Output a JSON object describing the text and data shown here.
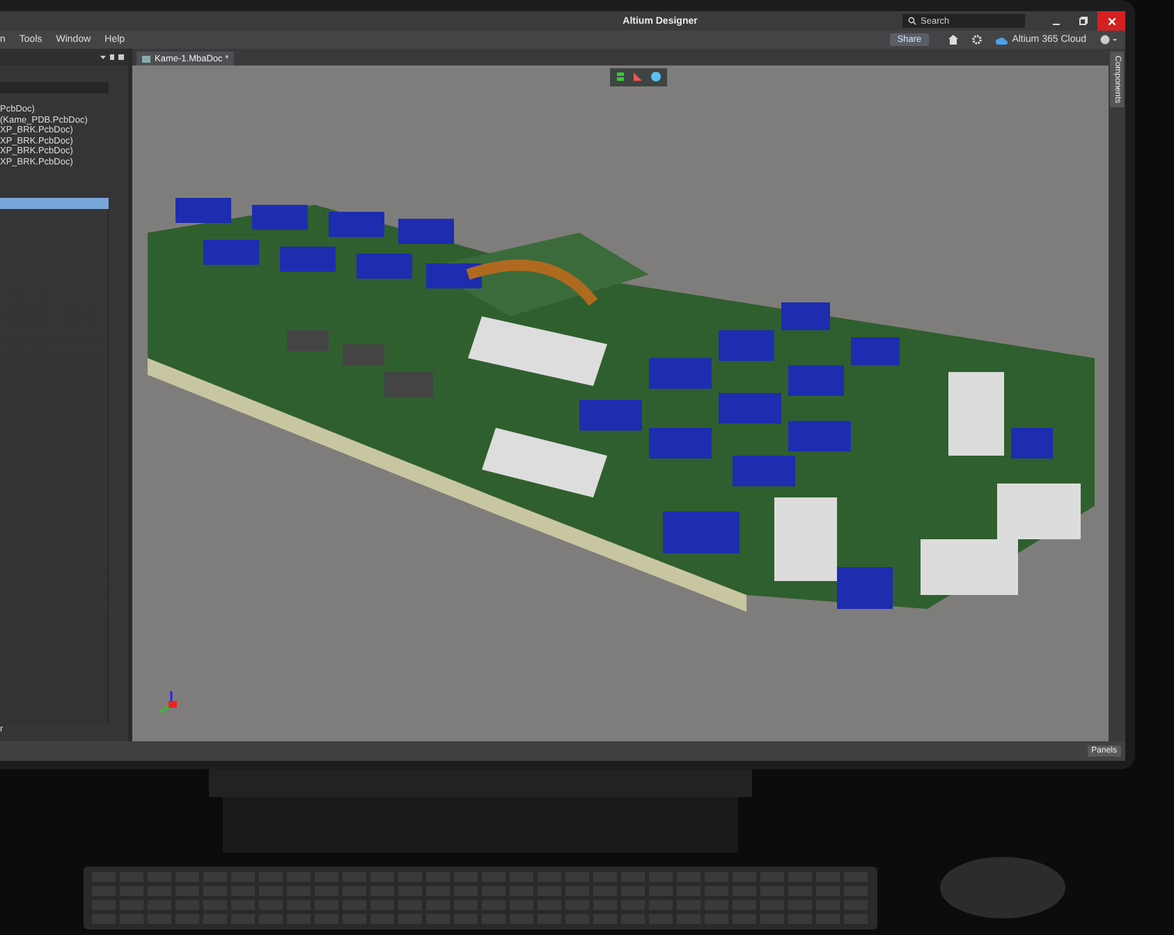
{
  "window": {
    "title": "Altium Designer"
  },
  "search": {
    "placeholder": "Search"
  },
  "menu": [
    "n",
    "Tools",
    "Window",
    "Help"
  ],
  "toolbar": {
    "share": "Share",
    "cloud": "Altium 365 Cloud"
  },
  "left_panel": {
    "items": [
      {
        "label": "PcbDoc)",
        "selected": false
      },
      {
        "label": "(Kame_PDB.PcbDoc)",
        "selected": false
      },
      {
        "label": "XP_BRK.PcbDoc)",
        "selected": false
      },
      {
        "label": "XP_BRK.PcbDoc)",
        "selected": false
      },
      {
        "label": "XP_BRK.PcbDoc)",
        "selected": false
      },
      {
        "label": "XP_BRK.PcbDoc)",
        "selected": false
      }
    ],
    "footer": "r"
  },
  "document_tab": {
    "label": "Kame-1.MbaDoc *",
    "selected": true
  },
  "side_panel_tab": "Components",
  "status_bar": {
    "panels": "Panels"
  }
}
